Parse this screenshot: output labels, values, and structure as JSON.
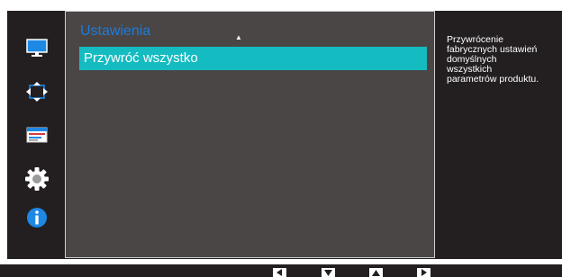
{
  "menu": {
    "title": "Ustawienia",
    "scroll_indicator": "▲",
    "items": [
      {
        "label": "Przywróć wszystko",
        "selected": true
      }
    ]
  },
  "help": {
    "text": "Przywrócenie\nfabrycznych ustawień\ndomyślnych\nwszystkich\nparametrów produktu."
  },
  "rail_icons": [
    "monitor-icon",
    "screen-size-icon",
    "adjustment-bars-icon",
    "settings-gear-icon",
    "information-icon"
  ],
  "nav_buttons": [
    "left-arrow-icon",
    "down-arrow-icon",
    "up-arrow-icon",
    "right-arrow-icon"
  ],
  "colors": {
    "background": "#231f20",
    "menu_panel": "#4a4646",
    "selection": "#14bcc1",
    "title": "#1f7bd8",
    "icon_blue": "#1e88e5"
  }
}
